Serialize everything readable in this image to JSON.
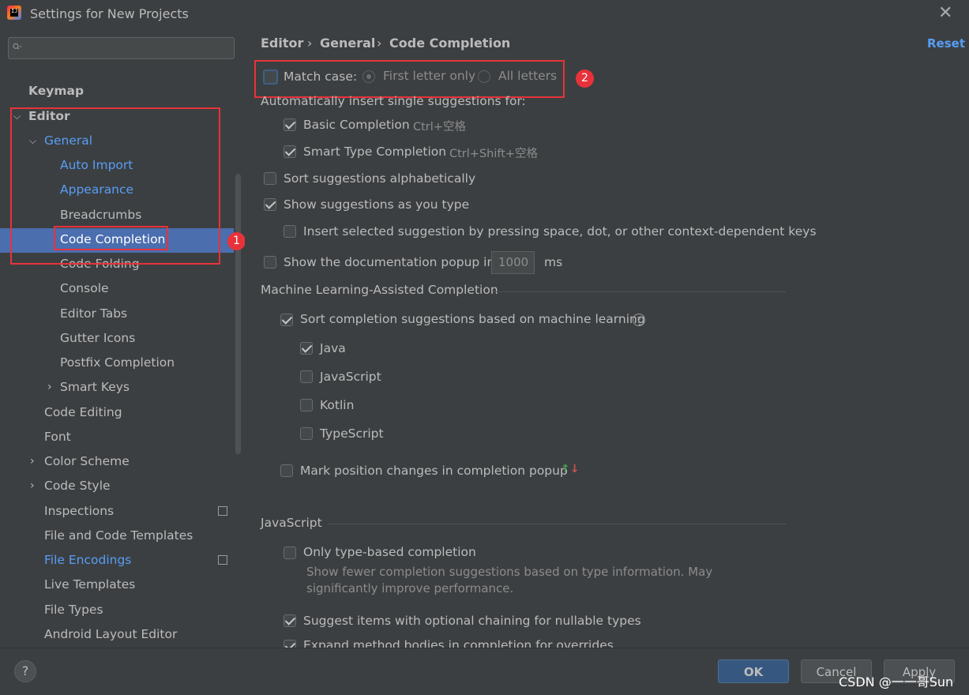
{
  "window": {
    "title": "Settings for New Projects"
  },
  "search": {
    "placeholder": ""
  },
  "sidebar": {
    "items": [
      {
        "label": "Keymap"
      },
      {
        "label": "Editor"
      },
      {
        "label": "General"
      },
      {
        "label": "Auto Import"
      },
      {
        "label": "Appearance"
      },
      {
        "label": "Breadcrumbs"
      },
      {
        "label": "Code Completion"
      },
      {
        "label": "Code Folding"
      },
      {
        "label": "Console"
      },
      {
        "label": "Editor Tabs"
      },
      {
        "label": "Gutter Icons"
      },
      {
        "label": "Postfix Completion"
      },
      {
        "label": "Smart Keys"
      },
      {
        "label": "Code Editing"
      },
      {
        "label": "Font"
      },
      {
        "label": "Color Scheme"
      },
      {
        "label": "Code Style"
      },
      {
        "label": "Inspections"
      },
      {
        "label": "File and Code Templates"
      },
      {
        "label": "File Encodings"
      },
      {
        "label": "Live Templates"
      },
      {
        "label": "File Types"
      },
      {
        "label": "Android Layout Editor"
      }
    ]
  },
  "breadcrumb": {
    "part1": "Editor",
    "part2": "General",
    "part3": "Code Completion",
    "sep": "›"
  },
  "reset_label": "Reset",
  "match_case": {
    "label": "Match case:",
    "option1": "First letter only",
    "option2": "All letters",
    "checked": false,
    "selected": "First letter only"
  },
  "auto_insert": {
    "label": "Automatically insert single suggestions for:"
  },
  "basic_completion": {
    "label": "Basic Completion",
    "shortcut": "Ctrl+空格",
    "checked": true
  },
  "smart_type": {
    "label": "Smart Type Completion",
    "shortcut": "Ctrl+Shift+空格",
    "checked": true
  },
  "sort_alpha": {
    "label": "Sort suggestions alphabetically",
    "checked": false
  },
  "show_as_type": {
    "label": "Show suggestions as you type",
    "checked": true
  },
  "insert_selected": {
    "label": "Insert selected suggestion by pressing space, dot, or other context-dependent keys",
    "checked": false
  },
  "doc_popup": {
    "label": "Show the documentation popup in",
    "value": "1000",
    "unit": "ms",
    "checked": false
  },
  "ml_section": {
    "title": "Machine Learning-Assisted Completion"
  },
  "ml_sort": {
    "label": "Sort completion suggestions based on machine learning",
    "checked": true
  },
  "ml_langs": [
    {
      "label": "Java",
      "checked": true
    },
    {
      "label": "JavaScript",
      "checked": false
    },
    {
      "label": "Kotlin",
      "checked": false
    },
    {
      "label": "TypeScript",
      "checked": false
    }
  ],
  "mark_position": {
    "label": "Mark position changes in completion popup",
    "checked": false
  },
  "js_section": {
    "title": "JavaScript"
  },
  "only_type_based": {
    "label": "Only type-based completion",
    "desc1": "Show fewer completion suggestions based on type information. May",
    "desc2": "significantly improve performance.",
    "checked": false
  },
  "suggest_optional": {
    "label": "Suggest items with optional chaining for nullable types",
    "checked": true
  },
  "expand_method": {
    "label": "Expand method bodies in completion for overrides",
    "checked": true
  },
  "annotations": {
    "num1": "1",
    "num2": "2"
  },
  "footer": {
    "help": "?",
    "ok": "OK",
    "cancel": "Cancel",
    "apply": "Apply"
  },
  "watermark": "CSDN @一一哥Sun",
  "colors": {
    "accent": "#589df6",
    "selection": "#4b6eaf",
    "annotation": "#e8323a"
  }
}
